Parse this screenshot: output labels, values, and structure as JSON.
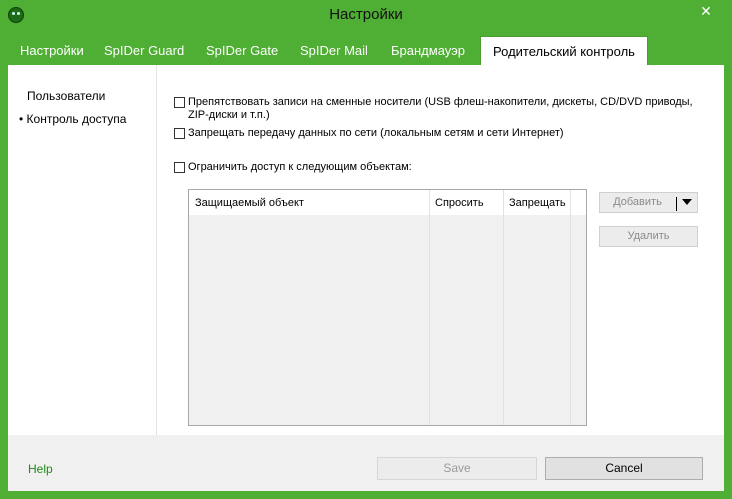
{
  "window": {
    "title": "Настройки",
    "close_glyph": "✕",
    "icon": "spider-icon"
  },
  "tabs": [
    {
      "label": "Настройки"
    },
    {
      "label": "SpIDer Guard"
    },
    {
      "label": "SpIDer Gate"
    },
    {
      "label": "SpIDer Mail"
    },
    {
      "label": "Брандмауэр"
    },
    {
      "label": "Родительский контроль",
      "active": true
    }
  ],
  "sidebar": {
    "items": [
      {
        "label": "Пользователи"
      },
      {
        "label": "• Контроль доступа",
        "selected": true
      }
    ]
  },
  "options": {
    "block_removable": {
      "label": "Препятствовать записи на сменные носители (USB флеш-накопители, дискеты, CD/DVD приводы, ZIP-диски и т.п.)",
      "checked": false
    },
    "block_network": {
      "label": "Запрещать передачу данных по сети (локальным сетям и сети Интернет)",
      "checked": false
    },
    "restrict_objects": {
      "label": "Ограничить доступ к следующим объектам:",
      "checked": false
    }
  },
  "table": {
    "columns": [
      "Защищаемый объект",
      "Спросить",
      "Запрещать"
    ],
    "rows": []
  },
  "actions": {
    "add_label": "Добавить",
    "delete_label": "Удалить"
  },
  "footer": {
    "help_label": "Help",
    "save_label": "Save",
    "cancel_label": "Cancel"
  },
  "colors": {
    "accent": "#4fae34",
    "help_link": "#1e8a14"
  }
}
